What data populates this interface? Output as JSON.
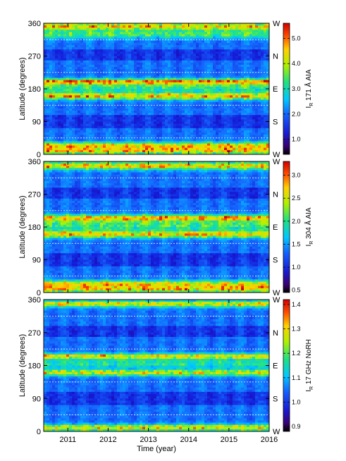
{
  "chart_data": [
    {
      "type": "heatmap",
      "panel": 1,
      "ylabel": "Latitude (degrees)",
      "ytick_labels": [
        "0",
        "90",
        "180",
        "270",
        "360"
      ],
      "yticks": [
        0,
        90,
        180,
        270,
        360
      ],
      "ylim": [
        0,
        360
      ],
      "xlim": [
        2010.4,
        2016.0
      ],
      "right_labels": [
        "W",
        "N",
        "E",
        "S",
        "W"
      ],
      "right_label_values": [
        360,
        270,
        180,
        90,
        0
      ],
      "dashed_lines": [
        45,
        135,
        225,
        315
      ],
      "colorbar_label": "I_R 171 Å AIA",
      "colorbar_ticks": [
        "1.0",
        "2.0",
        "3.0",
        "4.0",
        "5.0"
      ],
      "colorbar_tick_values": [
        1.0,
        2.0,
        3.0,
        4.0,
        5.0
      ],
      "colorbar_range": [
        0.4,
        5.6
      ],
      "bands": [
        {
          "lat": 352,
          "width": 10,
          "strength": 0.95
        },
        {
          "lat": 330,
          "width": 12,
          "strength": 0.55
        },
        {
          "lat": 200,
          "width": 8,
          "strength": 0.95
        },
        {
          "lat": 160,
          "width": 10,
          "strength": 0.95
        },
        {
          "lat": 185,
          "width": 14,
          "strength": 0.5
        },
        {
          "lat": 25,
          "width": 9,
          "strength": 0.85
        },
        {
          "lat": 10,
          "width": 10,
          "strength": 0.95
        }
      ]
    },
    {
      "type": "heatmap",
      "panel": 2,
      "ylabel": "Latitude (degrees)",
      "ytick_labels": [
        "0",
        "90",
        "180",
        "270",
        "360"
      ],
      "yticks": [
        0,
        90,
        180,
        270,
        360
      ],
      "ylim": [
        0,
        360
      ],
      "xlim": [
        2010.4,
        2016.0
      ],
      "right_labels": [
        "W",
        "N",
        "E",
        "S",
        "W"
      ],
      "right_label_values": [
        360,
        270,
        180,
        90,
        0
      ],
      "dashed_lines": [
        45,
        135,
        225,
        315
      ],
      "colorbar_label": "I_R 304 Å AIA",
      "colorbar_ticks": [
        "0.5",
        "1.0",
        "1.5",
        "2.0",
        "2.5",
        "3.0"
      ],
      "colorbar_tick_values": [
        0.5,
        1.0,
        1.5,
        2.0,
        2.5,
        3.0
      ],
      "colorbar_range": [
        0.45,
        3.3
      ],
      "bands": [
        {
          "lat": 348,
          "width": 11,
          "strength": 0.95
        },
        {
          "lat": 205,
          "width": 9,
          "strength": 0.95
        },
        {
          "lat": 160,
          "width": 10,
          "strength": 0.95
        },
        {
          "lat": 185,
          "width": 14,
          "strength": 0.55
        },
        {
          "lat": 25,
          "width": 9,
          "strength": 0.8
        },
        {
          "lat": 10,
          "width": 10,
          "strength": 0.95
        }
      ]
    },
    {
      "type": "heatmap",
      "panel": 3,
      "xlabel": "Time (year)",
      "xtick_labels": [
        "2011",
        "2012",
        "2013",
        "2014",
        "2015",
        "2016"
      ],
      "xticks": [
        2011,
        2012,
        2013,
        2014,
        2015,
        2016
      ],
      "ylabel": "Latitude (degrees)",
      "ytick_labels": [
        "0",
        "90",
        "180",
        "270",
        "360"
      ],
      "yticks": [
        0,
        90,
        180,
        270,
        360
      ],
      "ylim": [
        0,
        360
      ],
      "xlim": [
        2010.4,
        2016.0
      ],
      "right_labels": [
        "W",
        "N",
        "E",
        "S",
        "W"
      ],
      "right_label_values": [
        360,
        270,
        180,
        90,
        0
      ],
      "dashed_lines": [
        45,
        135,
        225,
        315
      ],
      "colorbar_label": "I_R 17 GHz NoRH",
      "colorbar_ticks": [
        "0.9",
        "1.0",
        "1.1",
        "1.2",
        "1.3",
        "1.4"
      ],
      "colorbar_tick_values": [
        0.9,
        1.0,
        1.1,
        1.2,
        1.3,
        1.4
      ],
      "colorbar_range": [
        0.88,
        1.42
      ],
      "bands": [
        {
          "lat": 348,
          "width": 9,
          "strength": 0.9
        },
        {
          "lat": 205,
          "width": 8,
          "strength": 0.9
        },
        {
          "lat": 160,
          "width": 9,
          "strength": 0.85
        },
        {
          "lat": 185,
          "width": 12,
          "strength": 0.45
        },
        {
          "lat": 10,
          "width": 9,
          "strength": 0.9
        }
      ]
    }
  ]
}
